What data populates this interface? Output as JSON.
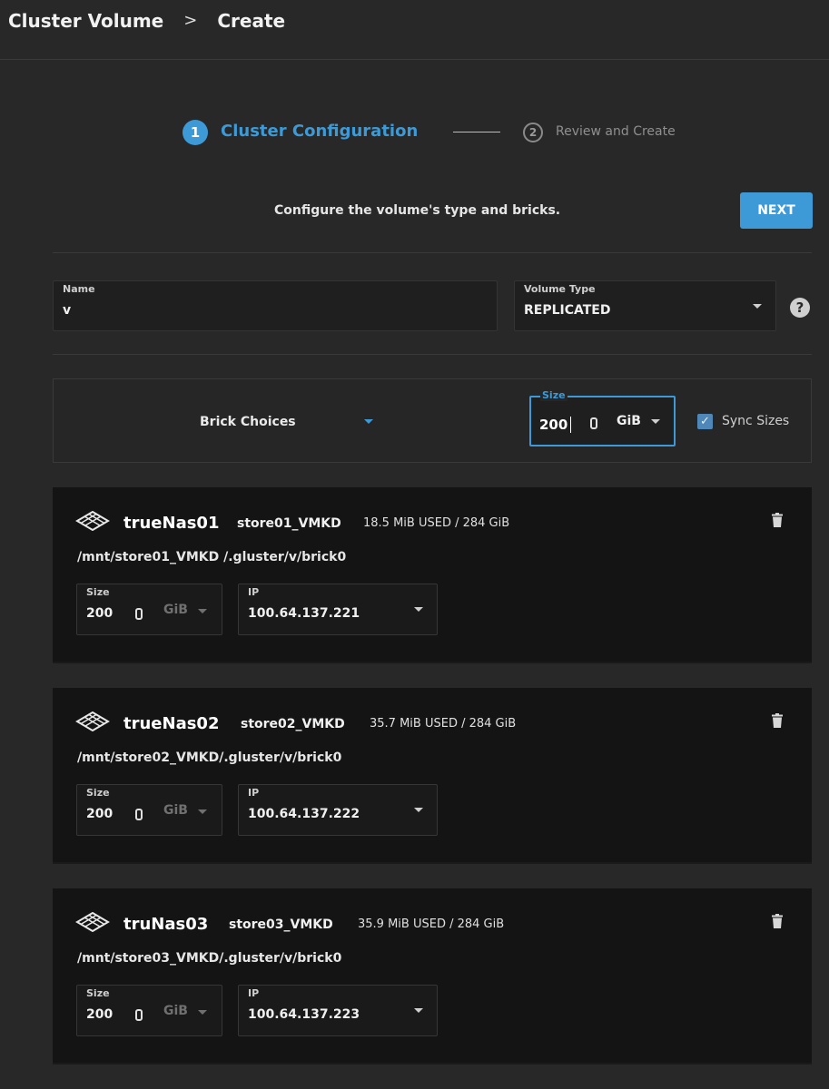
{
  "header": {
    "title": "Cluster Volume",
    "separator": ">",
    "current": "Create"
  },
  "stepper": {
    "steps": [
      {
        "number": "1",
        "label": "Cluster Configuration",
        "active": true
      },
      {
        "number": "2",
        "label": "Review and Create",
        "active": false
      }
    ]
  },
  "instructions": "Configure the volume's type and bricks.",
  "next_label": "NEXT",
  "name_field": {
    "label": "Name",
    "value": "v"
  },
  "volume_type": {
    "label": "Volume Type",
    "value": "REPLICATED"
  },
  "help_glyph": "?",
  "brick_choices": {
    "label": "Brick Choices"
  },
  "size_field": {
    "label": "Size",
    "value": "200",
    "unit": "GiB"
  },
  "sync_sizes": {
    "label": "Sync Sizes",
    "checked": true,
    "check_glyph": "✓"
  },
  "bricks": [
    {
      "host": "trueNas01",
      "store": "store01_VMKD",
      "usage": "18.5 MiB USED / 284 GiB",
      "path": "/mnt/store01_VMKD /.gluster/v/brick0",
      "size_label": "Size",
      "size": "200",
      "unit": "GiB",
      "ip_label": "IP",
      "ip": "100.64.137.221"
    },
    {
      "host": "trueNas02",
      "store": "store02_VMKD",
      "usage": "35.7 MiB USED / 284 GiB",
      "path": "/mnt/store02_VMKD/.gluster/v/brick0",
      "size_label": "Size",
      "size": "200",
      "unit": "GiB",
      "ip_label": "IP",
      "ip": "100.64.137.222"
    },
    {
      "host": "truNas03",
      "store": "store03_VMKD",
      "usage": "35.9 MiB USED / 284 GiB",
      "path": "/mnt/store03_VMKD/.gluster/v/brick0",
      "size_label": "Size",
      "size": "200",
      "unit": "GiB",
      "ip_label": "IP",
      "ip": "100.64.137.223"
    }
  ],
  "icons": {
    "node": "server-node-icon",
    "delete": "trash-icon",
    "help": "help-icon"
  },
  "colors": {
    "accent": "#3d9ad6",
    "background": "#282828",
    "card": "#141414"
  }
}
